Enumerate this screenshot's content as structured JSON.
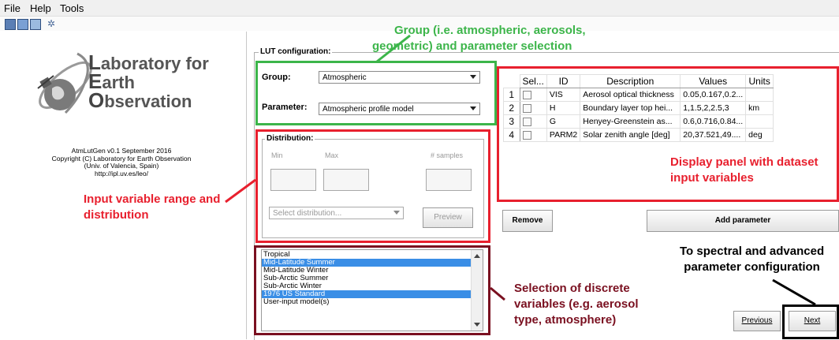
{
  "menu": [
    "File",
    "Help",
    "Tools"
  ],
  "toolbar": {
    "icons": [
      "save-icon",
      "open-icon",
      "export-icon",
      "settings-icon"
    ]
  },
  "logo": {
    "l1": "aboratory for",
    "l2": "arth",
    "l3": "bservation",
    "b1": "L",
    "b2": "E",
    "b3": "O"
  },
  "about": {
    "line1": "AtmLutGen v0.1 September 2016",
    "line2": "Copyright (C) Laboratory for Earth Observation",
    "line3": "(Univ. of Valencia, Spain)",
    "line4": "http://ipl.uv.es/leo/"
  },
  "lut": {
    "title": "LUT configuration:",
    "group_label": "Group:",
    "group_value": "Atmospheric",
    "parameter_label": "Parameter:",
    "parameter_value": "Atmospheric profile model"
  },
  "distribution": {
    "title": "Distribution:",
    "min": "Min",
    "max": "Max",
    "samples": "# samples",
    "select_placeholder": "Select distribution...",
    "preview": "Preview"
  },
  "table": {
    "headers": [
      "Sel...",
      "ID",
      "Description",
      "Values",
      "Units"
    ],
    "rows": [
      {
        "num": "1",
        "id": "VIS",
        "desc": "Aerosol optical thickness",
        "values": "0.05,0.167,0.2...",
        "units": ""
      },
      {
        "num": "2",
        "id": "H",
        "desc": "Boundary layer top hei...",
        "values": "1,1.5,2,2.5,3",
        "units": "km"
      },
      {
        "num": "3",
        "id": "G",
        "desc": "Henyey-Greenstein as...",
        "values": "0.6,0.716,0.84...",
        "units": ""
      },
      {
        "num": "4",
        "id": "PARM2",
        "desc": "Solar zenith angle [deg]",
        "values": "20,37.521,49....",
        "units": "deg"
      }
    ]
  },
  "buttons": {
    "remove": "Remove",
    "add": "Add parameter",
    "previous": "Previous",
    "next": "Next"
  },
  "list": {
    "items": [
      "Tropical",
      "Mid-Latitude Summer",
      "Mid-Latitude Winter",
      "Sub-Arctic Summer",
      "Sub-Arctic Winter",
      "1976 US Standard",
      "User-input model(s)"
    ],
    "selected": [
      1,
      5
    ]
  },
  "annotations": {
    "group1": "Group (i.e. atmospheric, aerosols,",
    "group2": "geometric) and parameter selection",
    "display1": "Display panel with dataset",
    "display2": "input variables",
    "input1": "Input variable range and",
    "input2": "distribution",
    "sel1": "Selection of discrete",
    "sel2": "variables (e.g. aerosol",
    "sel3": "type, atmosphere)",
    "spec1": "To spectral and advanced",
    "spec2": "parameter configuration"
  },
  "colors": {
    "green": "#3cb54a",
    "red": "#e8202e",
    "maroon": "#7a1020",
    "selection": "#3a8ee6"
  }
}
